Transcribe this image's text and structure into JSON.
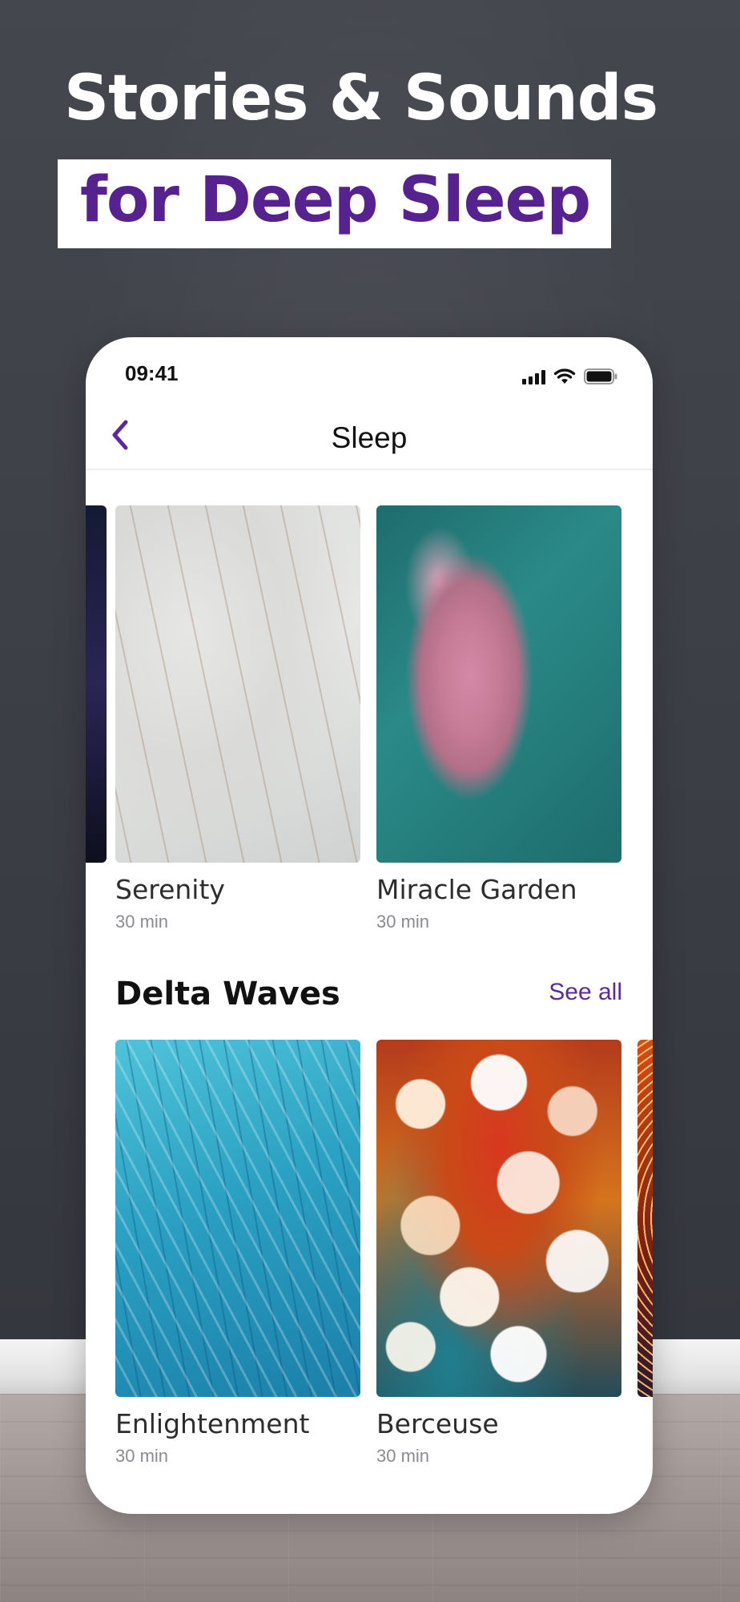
{
  "promo": {
    "headline_line1": "Stories & Sounds",
    "headline_line2": "for Deep Sleep"
  },
  "status_bar": {
    "time": "09:41"
  },
  "nav": {
    "title": "Sleep"
  },
  "top_row": {
    "cards": [
      {
        "title": "Serenity",
        "duration": "30 min"
      },
      {
        "title": "Miracle Garden",
        "duration": "30 min"
      }
    ]
  },
  "section": {
    "title": "Delta Waves",
    "see_all_label": "See all"
  },
  "delta_row": {
    "cards": [
      {
        "title": "Enlightenment",
        "duration": "30 min"
      },
      {
        "title": "Berceuse",
        "duration": "30 min"
      }
    ]
  },
  "colors": {
    "accent": "#5b2aa0",
    "headline_purple": "#55228f",
    "wall": "#3c3e46"
  }
}
